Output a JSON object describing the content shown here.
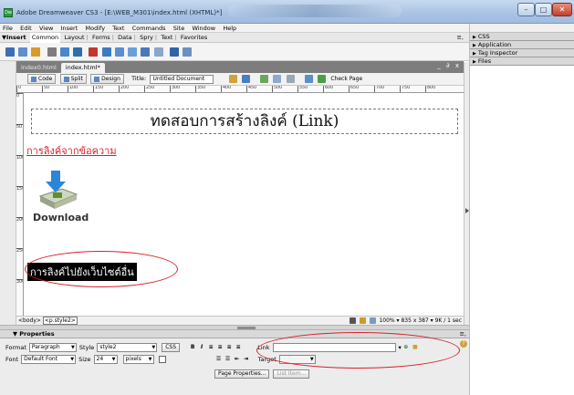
{
  "window": {
    "title": "Adobe Dreamweaver CS3 - [E:\\WEB_M301\\index.html (XHTML)*]",
    "app_icon": "Dw",
    "min_label": "–",
    "max_label": "□",
    "close_label": "✕"
  },
  "menu": [
    "File",
    "Edit",
    "View",
    "Insert",
    "Modify",
    "Text",
    "Commands",
    "Site",
    "Window",
    "Help"
  ],
  "insert_bar": {
    "toggle_label": "▼Insert",
    "active_tab": "Common",
    "tabs": [
      "Layout",
      "Forms",
      "Data",
      "Spry",
      "Text",
      "Favorites"
    ],
    "options_icon": "≡,"
  },
  "right_panels": [
    "CSS",
    "Application",
    "Tag Inspector",
    "Files"
  ],
  "doc_tabs": {
    "items": [
      "index0.html",
      "index.html*"
    ],
    "active_index": 1,
    "window_controls": "_ ∂ x"
  },
  "doc_toolbar": {
    "code_label": "Code",
    "split_label": "Split",
    "design_label": "Design",
    "title_label": "Title:",
    "title_value": "Untitled Document",
    "check_page_label": "Check Page"
  },
  "ruler": {
    "ticks": [
      "0",
      "50",
      "100",
      "150",
      "200",
      "250",
      "300",
      "350",
      "400",
      "450",
      "500",
      "550",
      "600",
      "650",
      "700",
      "750",
      "800"
    ]
  },
  "vruler": {
    "ticks": [
      "0",
      "50",
      "100",
      "150",
      "200",
      "250",
      "300"
    ]
  },
  "design_view": {
    "heading": "ทดสอบการสร้างลิงค์ (Link)",
    "text_link": "การลิงค์จากข้อความ",
    "download_label": "Download",
    "selected_text": "การลิงค์ไปยังเว็บไซต์อื่น"
  },
  "status_bar": {
    "tag_body": "<body>",
    "tag_p": "<p.style2>",
    "zoom": "100%",
    "dimensions": "835 x 387",
    "size_time": "9K / 1 sec"
  },
  "properties": {
    "header": "▼ Properties",
    "options_icon": "≡,",
    "format_label": "Format",
    "format_value": "Paragraph",
    "style_label": "Style",
    "style_value": "style2",
    "css_button": "CSS",
    "bold": "B",
    "italic": "I",
    "link_label": "Link",
    "link_value": "",
    "font_label": "Font",
    "font_value": "Default Font",
    "size_label": "Size",
    "size_value": "24",
    "size_unit": "pixels",
    "target_label": "Target",
    "page_properties_button": "Page Properties...",
    "list_item_button": "List Item...",
    "help_icon": "?"
  },
  "annotation_color": "#d8202a"
}
